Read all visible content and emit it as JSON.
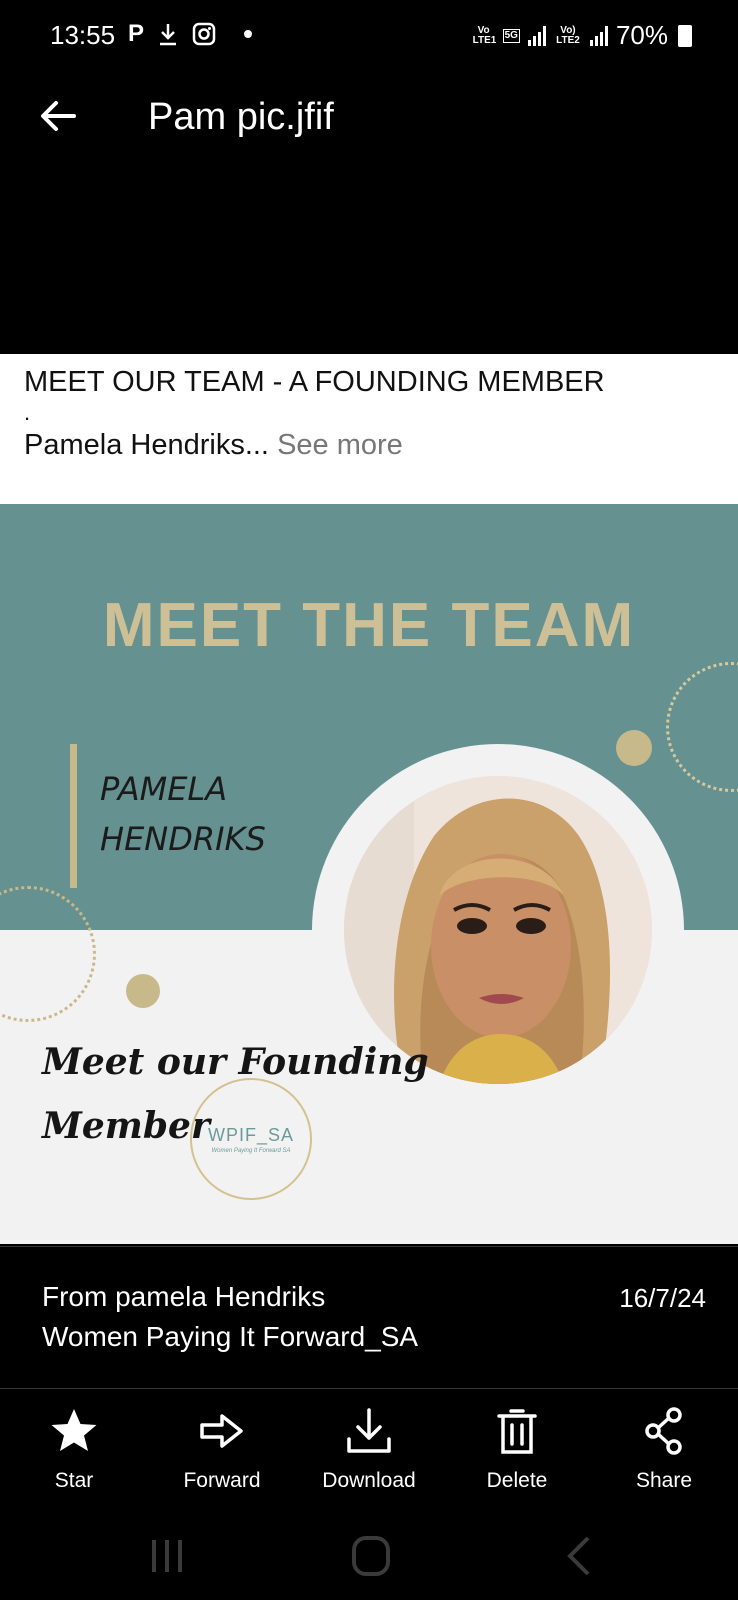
{
  "status_bar": {
    "time": "13:55",
    "left_icons": [
      "parking-icon",
      "download-icon",
      "instagram-icon",
      "dot-icon"
    ],
    "sim1_label": "Vo LTE1",
    "network": "5G",
    "sim2_label": "Vo) LTE2",
    "battery": "70%"
  },
  "app_bar": {
    "title": "Pam pic.jfif"
  },
  "caption": {
    "line1": "MEET OUR TEAM - A FOUNDING MEMBER",
    "dot": ".",
    "line2": "Pamela Hendriks...",
    "see_more": "See more"
  },
  "image": {
    "heading": "MEET THE TEAM",
    "name_line1": "PAMELA",
    "name_line2": "HENDRIKS",
    "script_line1": "Meet our Founding",
    "script_line2": "Member",
    "logo_name": "WPIF_SA",
    "logo_tagline": "Women Paying It Forward SA",
    "colors": {
      "teal": "#659191",
      "gold": "#c8b98b",
      "light": "#f2f2f2"
    }
  },
  "info": {
    "from": "From pamela Hendriks",
    "group": "Women Paying It Forward_SA",
    "date": "16/7/24"
  },
  "actions": [
    {
      "label": "Star",
      "icon": "star-icon"
    },
    {
      "label": "Forward",
      "icon": "forward-icon"
    },
    {
      "label": "Download",
      "icon": "download-icon"
    },
    {
      "label": "Delete",
      "icon": "trash-icon"
    },
    {
      "label": "Share",
      "icon": "share-icon"
    }
  ],
  "navbar": [
    "recents-icon",
    "home-icon",
    "back-icon"
  ]
}
